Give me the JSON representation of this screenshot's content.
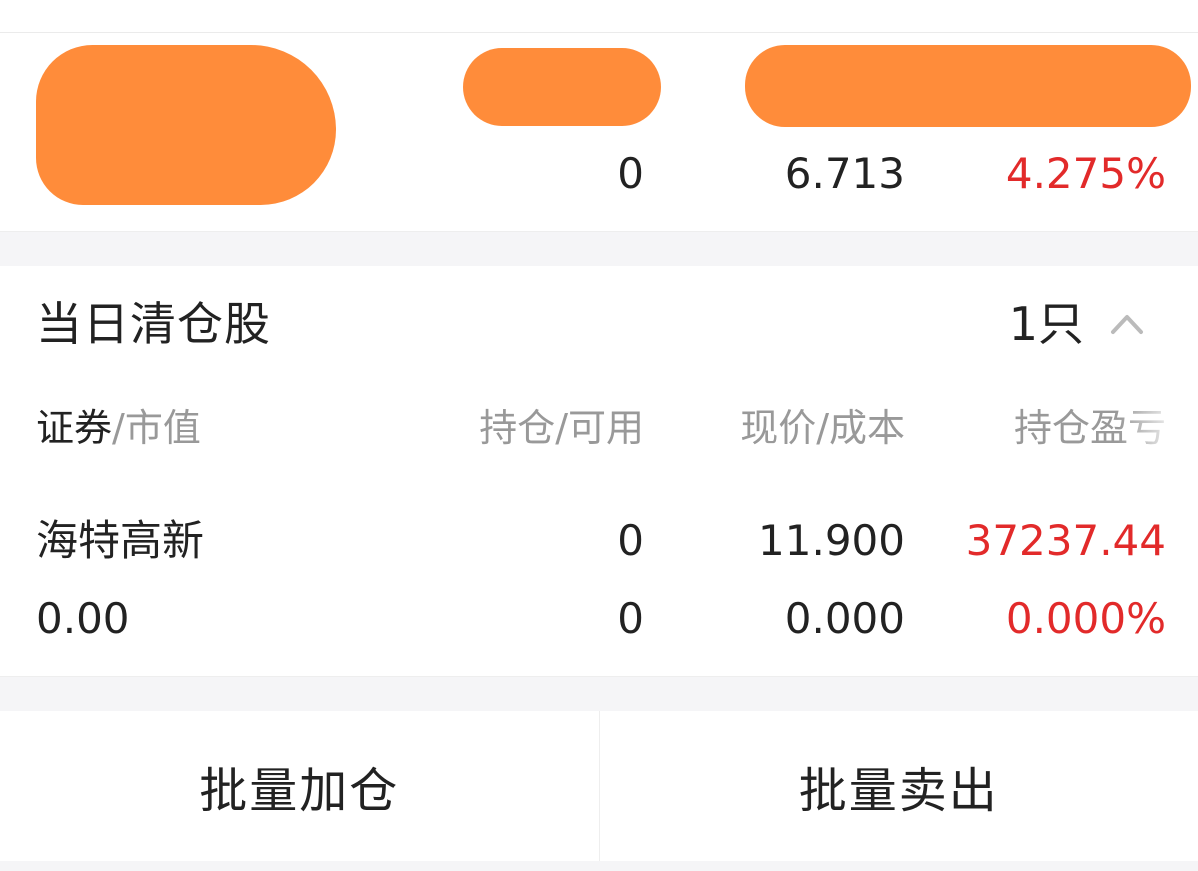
{
  "top_position": {
    "position": "0",
    "current_price": "6.713",
    "pnl_ratio": "4.275%"
  },
  "cleared_section": {
    "title": "当日清仓股",
    "count": "1只",
    "columns": {
      "security": "证券",
      "market_value": "/市值",
      "position": "持仓/可用",
      "price": "现价/成本",
      "pnl": "持仓盈亏"
    },
    "rows": [
      {
        "name": "海特高新",
        "market_value": "0.00",
        "position": "0",
        "available": "0",
        "current_price": "11.900",
        "cost": "0.000",
        "pnl": "37237.44",
        "pnl_ratio": "0.000%"
      }
    ]
  },
  "actions": {
    "batch_add": "批量加仓",
    "batch_sell": "批量卖出"
  },
  "colors": {
    "profit_red": "#e22a2a",
    "text_main": "#222222",
    "text_secondary": "#999999",
    "redaction": "#ff8c3a"
  },
  "icons": {
    "collapse": "chevron-up-icon"
  }
}
